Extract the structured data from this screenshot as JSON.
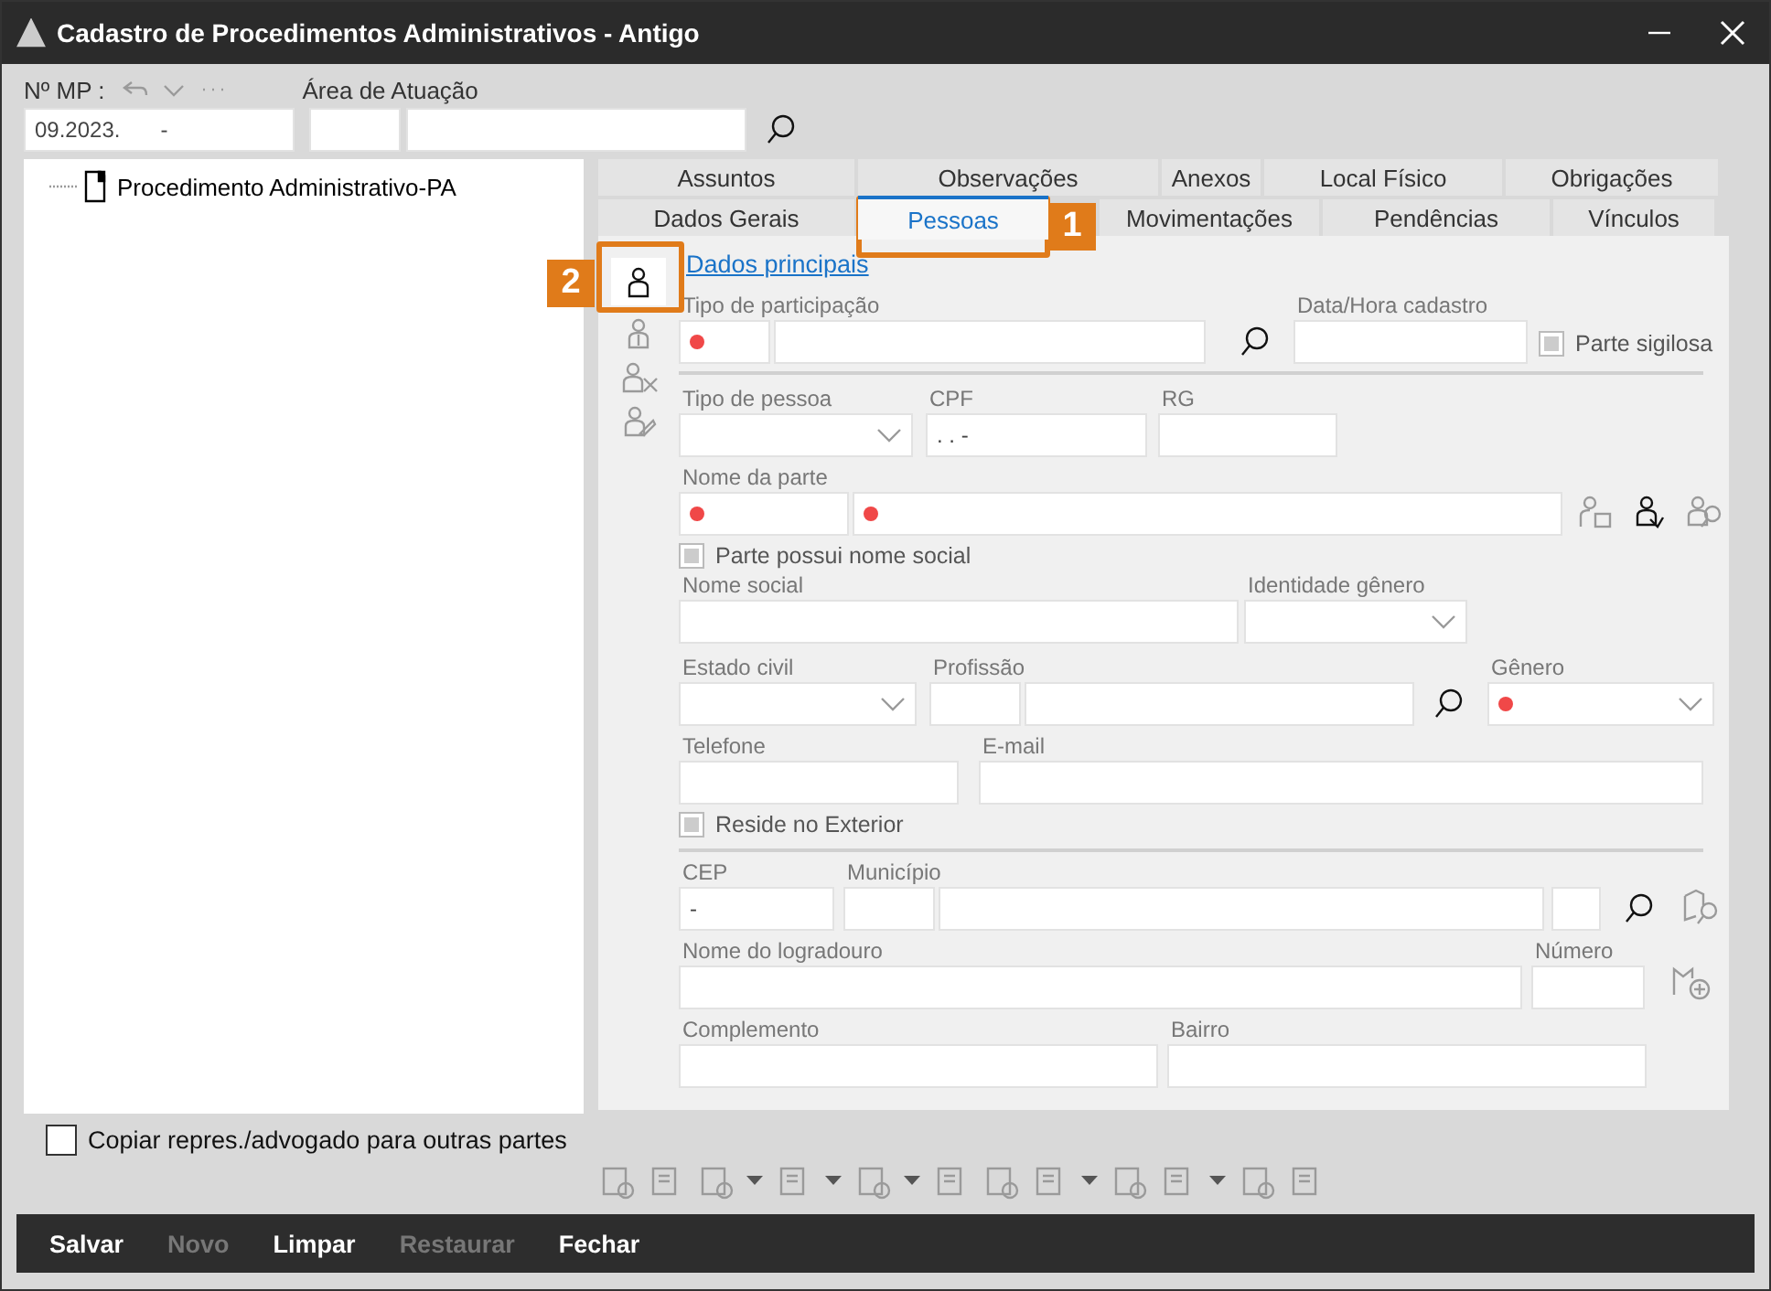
{
  "window": {
    "title": "Cadastro de Procedimentos Administrativos - Antigo"
  },
  "header": {
    "mp_label": "Nº MP :",
    "mp_value": "09.2023.",
    "mp_value_suffix": "-",
    "area_label": "Área de Atuação"
  },
  "tree": {
    "items": [
      {
        "label": "Procedimento Administrativo-PA",
        "selected": false
      }
    ]
  },
  "copy_option": {
    "label": "Copiar repres./advogado para outras partes",
    "checked": false
  },
  "tabs": [
    [
      {
        "label": "Assuntos",
        "selected": false
      },
      {
        "label": "Observações",
        "selected": false
      },
      {
        "label": "Anexos",
        "selected": false
      },
      {
        "label": "Local Físico",
        "selected": false
      },
      {
        "label": "Obrigações",
        "selected": false
      }
    ],
    [
      {
        "label": "Dados Gerais",
        "selected": false
      },
      {
        "label": "Pessoas",
        "selected": true
      },
      {
        "label": "Movimentações",
        "selected": false
      },
      {
        "label": "Pendências",
        "selected": false
      },
      {
        "label": "Vínculos",
        "selected": false
      }
    ]
  ],
  "section_link": "Dados principais",
  "form": {
    "tipo_participacao": {
      "label": "Tipo de participação",
      "required": true
    },
    "data_hora": {
      "label": "Data/Hora cadastro"
    },
    "parte_sigilosa": {
      "label": "Parte sigilosa",
      "checked": false
    },
    "tipo_pessoa": {
      "label": "Tipo de pessoa"
    },
    "cpf": {
      "label": "CPF",
      "value": ".  .  -"
    },
    "rg": {
      "label": "RG"
    },
    "nome_parte": {
      "label": "Nome da parte",
      "required": true
    },
    "nome_social_flag": {
      "label": "Parte possui nome social",
      "checked": false
    },
    "nome_social": {
      "label": "Nome social"
    },
    "identidade_genero": {
      "label": "Identidade gênero"
    },
    "estado_civil": {
      "label": "Estado civil"
    },
    "profissao": {
      "label": "Profissão"
    },
    "genero": {
      "label": "Gênero",
      "required": true
    },
    "telefone": {
      "label": "Telefone"
    },
    "email": {
      "label": "E-mail"
    },
    "reside_exterior": {
      "label": "Reside no Exterior",
      "checked": false
    },
    "cep": {
      "label": "CEP",
      "value": "-"
    },
    "municipio": {
      "label": "Município"
    },
    "logradouro": {
      "label": "Nome do logradouro"
    },
    "numero": {
      "label": "Número"
    },
    "complemento": {
      "label": "Complemento"
    },
    "bairro": {
      "label": "Bairro"
    }
  },
  "buttons": [
    {
      "label": "Salvar",
      "disabled": false
    },
    {
      "label": "Novo",
      "disabled": true
    },
    {
      "label": "Limpar",
      "disabled": false
    },
    {
      "label": "Restaurar",
      "disabled": true
    },
    {
      "label": "Fechar",
      "disabled": false
    }
  ],
  "callouts": [
    {
      "label": "1"
    },
    {
      "label": "2"
    }
  ]
}
